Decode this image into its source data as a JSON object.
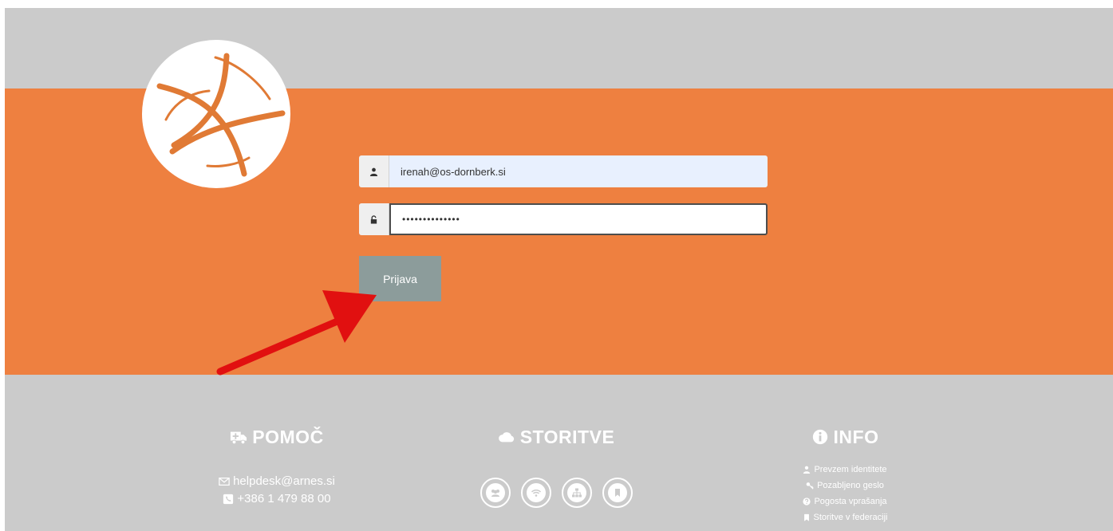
{
  "colors": {
    "background": "#cbcbcb",
    "band": "#ee8040",
    "button": "#8c9c9b",
    "logo_stroke": "#e07a35",
    "annotation_arrow": "#e11010"
  },
  "login": {
    "username_value": "irenah@os-dornberk.si",
    "username_icon": "user-icon",
    "password_value": "••••••••••••••",
    "password_icon": "lock-icon",
    "submit_label": "Prijava"
  },
  "footer": {
    "help": {
      "title": "POMOČ",
      "icon": "ambulance-icon",
      "email": "helpdesk@arnes.si",
      "email_icon": "envelope-icon",
      "phone": "+386 1 479 88 00",
      "phone_icon": "phone-icon"
    },
    "services": {
      "title": "STORITVE",
      "icon": "cloud-icon",
      "items": [
        "users-icon",
        "wifi-icon",
        "sitemap-icon",
        "bookmark-icon"
      ]
    },
    "info": {
      "title": "INFO",
      "icon": "info-icon",
      "links": [
        "Prevzem identitete",
        "Pozabljeno geslo",
        "Pogosta vprašanja",
        "Storitve v federaciji"
      ]
    }
  }
}
